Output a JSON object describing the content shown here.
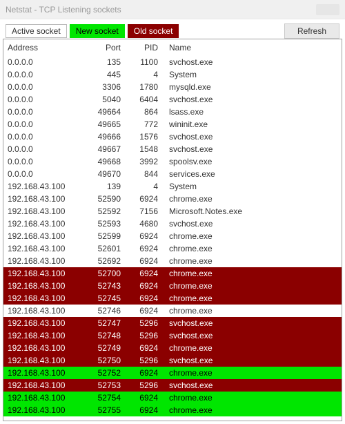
{
  "window": {
    "title": "Netstat - TCP Listening sockets"
  },
  "legend": {
    "active": "Active socket",
    "new": "New socket",
    "old": "Old socket"
  },
  "toolbar": {
    "refresh": "Refresh"
  },
  "columns": {
    "address": "Address",
    "port": "Port",
    "pid": "PID",
    "name": "Name"
  },
  "rows": [
    {
      "address": "0.0.0.0",
      "port": "135",
      "pid": "1100",
      "name": "svchost.exe",
      "state": "active"
    },
    {
      "address": "0.0.0.0",
      "port": "445",
      "pid": "4",
      "name": "System",
      "state": "active"
    },
    {
      "address": "0.0.0.0",
      "port": "3306",
      "pid": "1780",
      "name": "mysqld.exe",
      "state": "active"
    },
    {
      "address": "0.0.0.0",
      "port": "5040",
      "pid": "6404",
      "name": "svchost.exe",
      "state": "active"
    },
    {
      "address": "0.0.0.0",
      "port": "49664",
      "pid": "864",
      "name": "lsass.exe",
      "state": "active"
    },
    {
      "address": "0.0.0.0",
      "port": "49665",
      "pid": "772",
      "name": "wininit.exe",
      "state": "active"
    },
    {
      "address": "0.0.0.0",
      "port": "49666",
      "pid": "1576",
      "name": "svchost.exe",
      "state": "active"
    },
    {
      "address": "0.0.0.0",
      "port": "49667",
      "pid": "1548",
      "name": "svchost.exe",
      "state": "active"
    },
    {
      "address": "0.0.0.0",
      "port": "49668",
      "pid": "3992",
      "name": "spoolsv.exe",
      "state": "active"
    },
    {
      "address": "0.0.0.0",
      "port": "49670",
      "pid": "844",
      "name": "services.exe",
      "state": "active"
    },
    {
      "address": "192.168.43.100",
      "port": "139",
      "pid": "4",
      "name": "System",
      "state": "active"
    },
    {
      "address": "192.168.43.100",
      "port": "52590",
      "pid": "6924",
      "name": "chrome.exe",
      "state": "active"
    },
    {
      "address": "192.168.43.100",
      "port": "52592",
      "pid": "7156",
      "name": "Microsoft.Notes.exe",
      "state": "active"
    },
    {
      "address": "192.168.43.100",
      "port": "52593",
      "pid": "4680",
      "name": "svchost.exe",
      "state": "active"
    },
    {
      "address": "192.168.43.100",
      "port": "52599",
      "pid": "6924",
      "name": "chrome.exe",
      "state": "active"
    },
    {
      "address": "192.168.43.100",
      "port": "52601",
      "pid": "6924",
      "name": "chrome.exe",
      "state": "active"
    },
    {
      "address": "192.168.43.100",
      "port": "52692",
      "pid": "6924",
      "name": "chrome.exe",
      "state": "active"
    },
    {
      "address": "192.168.43.100",
      "port": "52700",
      "pid": "6924",
      "name": "chrome.exe",
      "state": "old"
    },
    {
      "address": "192.168.43.100",
      "port": "52743",
      "pid": "6924",
      "name": "chrome.exe",
      "state": "old"
    },
    {
      "address": "192.168.43.100",
      "port": "52745",
      "pid": "6924",
      "name": "chrome.exe",
      "state": "old"
    },
    {
      "address": "192.168.43.100",
      "port": "52746",
      "pid": "6924",
      "name": "chrome.exe",
      "state": "active"
    },
    {
      "address": "192.168.43.100",
      "port": "52747",
      "pid": "5296",
      "name": "svchost.exe",
      "state": "old"
    },
    {
      "address": "192.168.43.100",
      "port": "52748",
      "pid": "5296",
      "name": "svchost.exe",
      "state": "old"
    },
    {
      "address": "192.168.43.100",
      "port": "52749",
      "pid": "6924",
      "name": "chrome.exe",
      "state": "old"
    },
    {
      "address": "192.168.43.100",
      "port": "52750",
      "pid": "5296",
      "name": "svchost.exe",
      "state": "old"
    },
    {
      "address": "192.168.43.100",
      "port": "52752",
      "pid": "6924",
      "name": "chrome.exe",
      "state": "new"
    },
    {
      "address": "192.168.43.100",
      "port": "52753",
      "pid": "5296",
      "name": "svchost.exe",
      "state": "old"
    },
    {
      "address": "192.168.43.100",
      "port": "52754",
      "pid": "6924",
      "name": "chrome.exe",
      "state": "new"
    },
    {
      "address": "192.168.43.100",
      "port": "52755",
      "pid": "6924",
      "name": "chrome.exe",
      "state": "new"
    }
  ]
}
